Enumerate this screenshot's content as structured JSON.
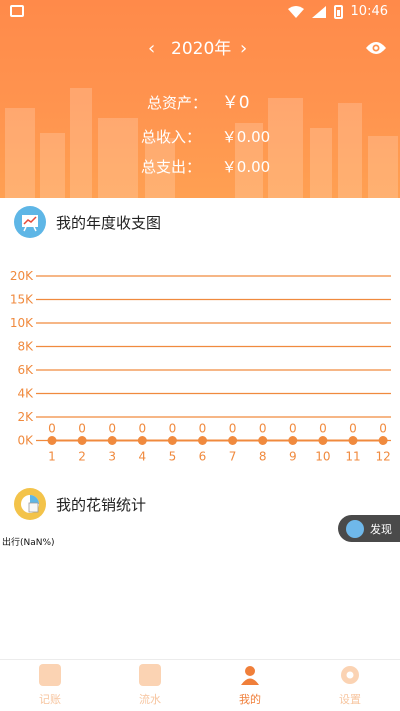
{
  "status_bar": {
    "time": "10:46"
  },
  "header": {
    "year": "2020年",
    "prev_label": "‹",
    "next_label": "›",
    "total_assets_label": "总资产：",
    "total_assets_value": "￥0",
    "total_income_label": "总收入：",
    "total_income_value": "￥0.00",
    "total_expense_label": "总支出：",
    "total_expense_value": "￥0.00"
  },
  "annual_section": {
    "title": "我的年度收支图"
  },
  "chart_data": {
    "type": "line",
    "x": [
      "1",
      "2",
      "3",
      "4",
      "5",
      "6",
      "7",
      "8",
      "9",
      "10",
      "11",
      "12"
    ],
    "y_ticks": [
      "20K",
      "15K",
      "10K",
      "8K",
      "6K",
      "4K",
      "2K",
      "0K"
    ],
    "series": [
      {
        "values": [
          0,
          0,
          0,
          0,
          0,
          0,
          0,
          0,
          0,
          0,
          0,
          0
        ]
      }
    ],
    "data_labels": [
      "0",
      "0",
      "0",
      "0",
      "0",
      "0",
      "0",
      "0",
      "0",
      "0",
      "0",
      "0"
    ],
    "grid": true,
    "color": "#f08a3e"
  },
  "spending_section": {
    "title": "我的花销统计",
    "legend": "出行(NaN%)"
  },
  "discover_button": {
    "label": "发现"
  },
  "bottom_nav": {
    "items": [
      {
        "label": "记账",
        "icon": "notebook-icon"
      },
      {
        "label": "流水",
        "icon": "trend-icon"
      },
      {
        "label": "我的",
        "icon": "user-icon"
      },
      {
        "label": "设置",
        "icon": "gear-icon"
      }
    ]
  },
  "colors": {
    "accent": "#f08a3e",
    "header": "#ff914d"
  }
}
